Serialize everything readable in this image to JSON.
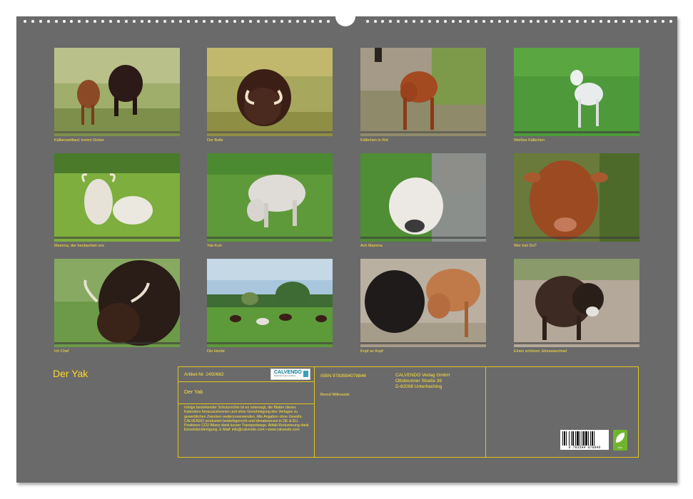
{
  "calendar": {
    "title": "Der Yak"
  },
  "photos": [
    {
      "caption": "Kälberwettlauf, komm Dicker",
      "icon": "calf-and-yak-photo"
    },
    {
      "caption": "Der Bulle",
      "icon": "yak-bull-photo"
    },
    {
      "caption": "Kälbchen in Rot",
      "icon": "red-calf-photo"
    },
    {
      "caption": "Weißes Kälbchen",
      "icon": "white-calf-photo"
    },
    {
      "caption": "Mamma, der beobachtet uns",
      "icon": "white-yak-mother-calf-photo"
    },
    {
      "caption": "Yak-Kuh",
      "icon": "white-yak-cow-photo"
    },
    {
      "caption": "Ach Mamma",
      "icon": "calf-face-photo"
    },
    {
      "caption": "Wer bist Du?",
      "icon": "brown-calf-face-photo"
    },
    {
      "caption": "Ich Chef",
      "icon": "yak-chief-photo"
    },
    {
      "caption": "Die Herde",
      "icon": "herd-landscape-photo"
    },
    {
      "caption": "Kopf an Kopf",
      "icon": "two-calves-photo"
    },
    {
      "caption": "Einen schönen Jahreswechsel",
      "icon": "dark-calf-photo"
    }
  ],
  "info": {
    "article_label": "Artikel-Nr. 2450682",
    "product_title": "Der Yak",
    "isbn": "ISBN 9783594078846",
    "author": "Bernd Witkowski",
    "publisher_line1": "CALVENDO Verlag GmbH",
    "publisher_line2": "Ottobrunner Straße 39",
    "publisher_line3": "D-82008 Unterhaching",
    "legal": "Infolge bestehender Schutzrechte ist es untersagt, die Blätter dieses Kalenders herauszutrennen und ohne Genehmigung des Verlages zu gewerblichen Zwecken weiterzuverwenden. Alle Angaben ohne Gewähr. CALVENDO produziert bedarfsgerecht und klimabewusst in DE & EU. Positivere CO2-Bilanz dank kurzer Transportwege. Abfall-Reduzierung dank Einzelstückfertigung. E-Mail: info@calvendo.com • www.calvendo.com",
    "logo_text": "CALVENDO",
    "logo_sub": "kalender-lesen-erleben",
    "barcode_number": "9 783594 078846",
    "eco_label": "eco"
  },
  "colors": {
    "page_bg": "#6a6a6a",
    "accent_yellow": "#ffe23a",
    "frame_yellow": "#e3c51a"
  }
}
